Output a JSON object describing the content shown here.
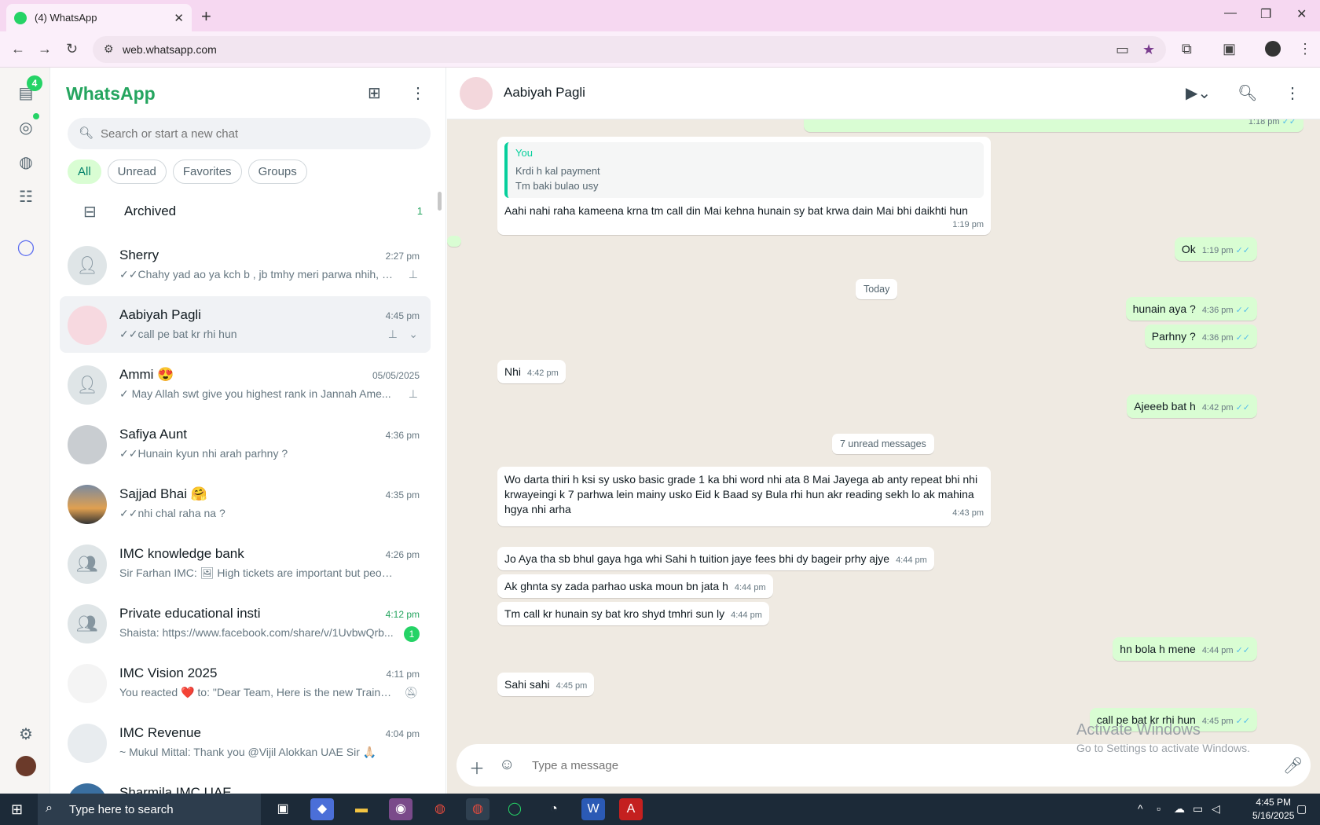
{
  "browser": {
    "tab_title": "(4) WhatsApp",
    "url": "web.whatsapp.com"
  },
  "rail": {
    "chats_badge": "4"
  },
  "sidebar": {
    "brand": "WhatsApp",
    "search_placeholder": "Search or start a new chat",
    "filters": [
      "All",
      "Unread",
      "Favorites",
      "Groups"
    ],
    "archived_label": "Archived",
    "archived_count": "1",
    "chats": [
      {
        "name": "Sherry",
        "time": "2:27 pm",
        "preview": "✓✓Chahy yad ao ya kch b , jb tmhy meri parwa nhih, na..."
      },
      {
        "name": "Aabiyah Pagli",
        "time": "4:45 pm",
        "preview": "✓✓call pe bat kr rhi hun"
      },
      {
        "name": "Ammi 😍",
        "time": "05/05/2025",
        "preview": "✓ May Allah swt give you highest rank in Jannah  Ame..."
      },
      {
        "name": "Safiya Aunt",
        "time": "4:36 pm",
        "preview": "✓✓Hunain kyun nhi arah parhny ?"
      },
      {
        "name": "Sajjad Bhai 🤗",
        "time": "4:35 pm",
        "preview": "✓✓nhi chal raha na ?"
      },
      {
        "name": "IMC knowledge bank",
        "time": "4:26 pm",
        "preview": "Sir Farhan IMC: 🖼 High tickets are important but people w..."
      },
      {
        "name": "Private educational insti",
        "time": "4:12 pm",
        "preview": "Shaista: https://www.facebook.com/share/v/1UvbwQrb...",
        "unread": "1"
      },
      {
        "name": "IMC Vision 2025",
        "time": "4:11 pm",
        "preview": "You reacted ❤️ to: \"Dear Team, Here is the new Trainer ..."
      },
      {
        "name": "IMC Revenue",
        "time": "4:04 pm",
        "preview": "~ Mukul Mittal: Thank you @Vijil Alokkan UAE Sir 🙏🏻"
      },
      {
        "name": "Sharmila IMC UAE",
        "time": "",
        "preview": ""
      }
    ]
  },
  "conversation": {
    "contact_name": "Aabiyah Pagli",
    "top_time": "1:18 pm",
    "messages": [
      {
        "dir": "in",
        "quote_who": "You",
        "quote_l1": "Krdi h kal payment",
        "quote_l2": "Tm baki bulao usy",
        "text": "Aahi nahi raha kameena krna tm call din Mai kehna hunain sy bat krwa dain Mai bhi daikhti hun",
        "time": "1:19 pm"
      },
      {
        "dir": "out",
        "text": "Ok",
        "time": "1:19 pm"
      },
      {
        "dir": "out",
        "text": "hunain aya ?",
        "time": "4:36 pm"
      },
      {
        "dir": "out",
        "text": "Parhny ?",
        "time": "4:36 pm"
      },
      {
        "dir": "in",
        "text": "Nhi",
        "time": "4:42 pm"
      },
      {
        "dir": "out",
        "text": "Ajeeeb bat h",
        "time": "4:42 pm"
      },
      {
        "dir": "in",
        "l1": "Wo darta thiri h ksi sy usko basic grade 1 ka bhi word nhi ata 8 Mai Jayega ab anty repeat bhi nhi",
        "l2": "krwayeingi k 7 parhwa lein mainy usko Eid k Baad sy Bula rhi hun akr reading sekh lo ak mahina",
        "l3": "hgya nhi arha",
        "time": "4:43 pm"
      },
      {
        "dir": "in",
        "text": "Jo Aya tha sb bhul gaya hga whi Sahi h tuition jaye fees bhi dy bageir prhy ajye",
        "time": "4:44 pm"
      },
      {
        "dir": "in",
        "text": "Ak ghnta sy zada parhao uska moun bn jata h",
        "time": "4:44 pm"
      },
      {
        "dir": "in",
        "text": "Tm call kr hunain sy bat kro shyd tmhri sun ly",
        "time": "4:44 pm"
      },
      {
        "dir": "out",
        "text": "hn bola h mene",
        "time": "4:44 pm"
      },
      {
        "dir": "in",
        "text": "Sahi sahi",
        "time": "4:45 pm"
      },
      {
        "dir": "out",
        "text": "call pe bat kr rhi hun",
        "time": "4:45 pm"
      }
    ],
    "date_today": "Today",
    "unread_label": "7 unread messages",
    "composer_placeholder": "Type a message",
    "watermark_title": "Activate Windows",
    "watermark_sub": "Go to Settings to activate Windows."
  },
  "taskbar": {
    "search_placeholder": "Type here to search",
    "time": "4:45 PM",
    "date": "5/16/2025"
  },
  "colors": {
    "accent": "#25d366",
    "brand_text": "#25a55f",
    "outgoing": "#d9fdd3",
    "tick": "#53bdeb"
  }
}
